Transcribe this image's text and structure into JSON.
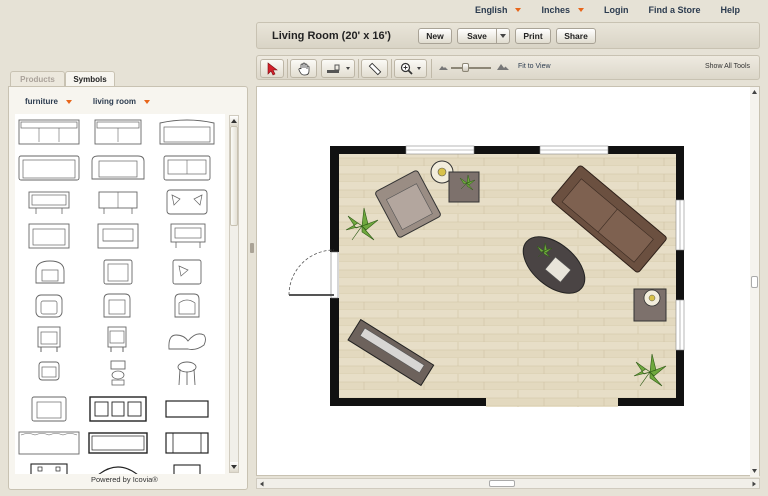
{
  "topnav": {
    "language": "English",
    "units": "Inches",
    "login": "Login",
    "find_store": "Find a Store",
    "help": "Help"
  },
  "titlebar": {
    "title": "Living Room (20' x 16')",
    "new_label": "New",
    "save_label": "Save",
    "print_label": "Print",
    "share_label": "Share"
  },
  "toolbar": {
    "fit_label": "Fit to View",
    "show_all_label": "Show All Tools"
  },
  "panel": {
    "tabs": [
      "Products",
      "Symbols"
    ],
    "active_tab": "Symbols",
    "filter_category": "furniture",
    "filter_room": "living room",
    "footer": "Powered by Icovia®"
  },
  "colors": {
    "accent_orange": "#e8651a",
    "nav_blue": "#2b3b4f",
    "wall": "#111111",
    "floor": "#e3d9bf",
    "sofa_brown": "#6b5040",
    "rug_dark": "#4a4444"
  },
  "icons": [
    "select-arrow-icon",
    "hand-icon",
    "measure-icon",
    "ruler-icon",
    "zoom-icon",
    "mountain-small-icon",
    "mountain-large-icon"
  ]
}
